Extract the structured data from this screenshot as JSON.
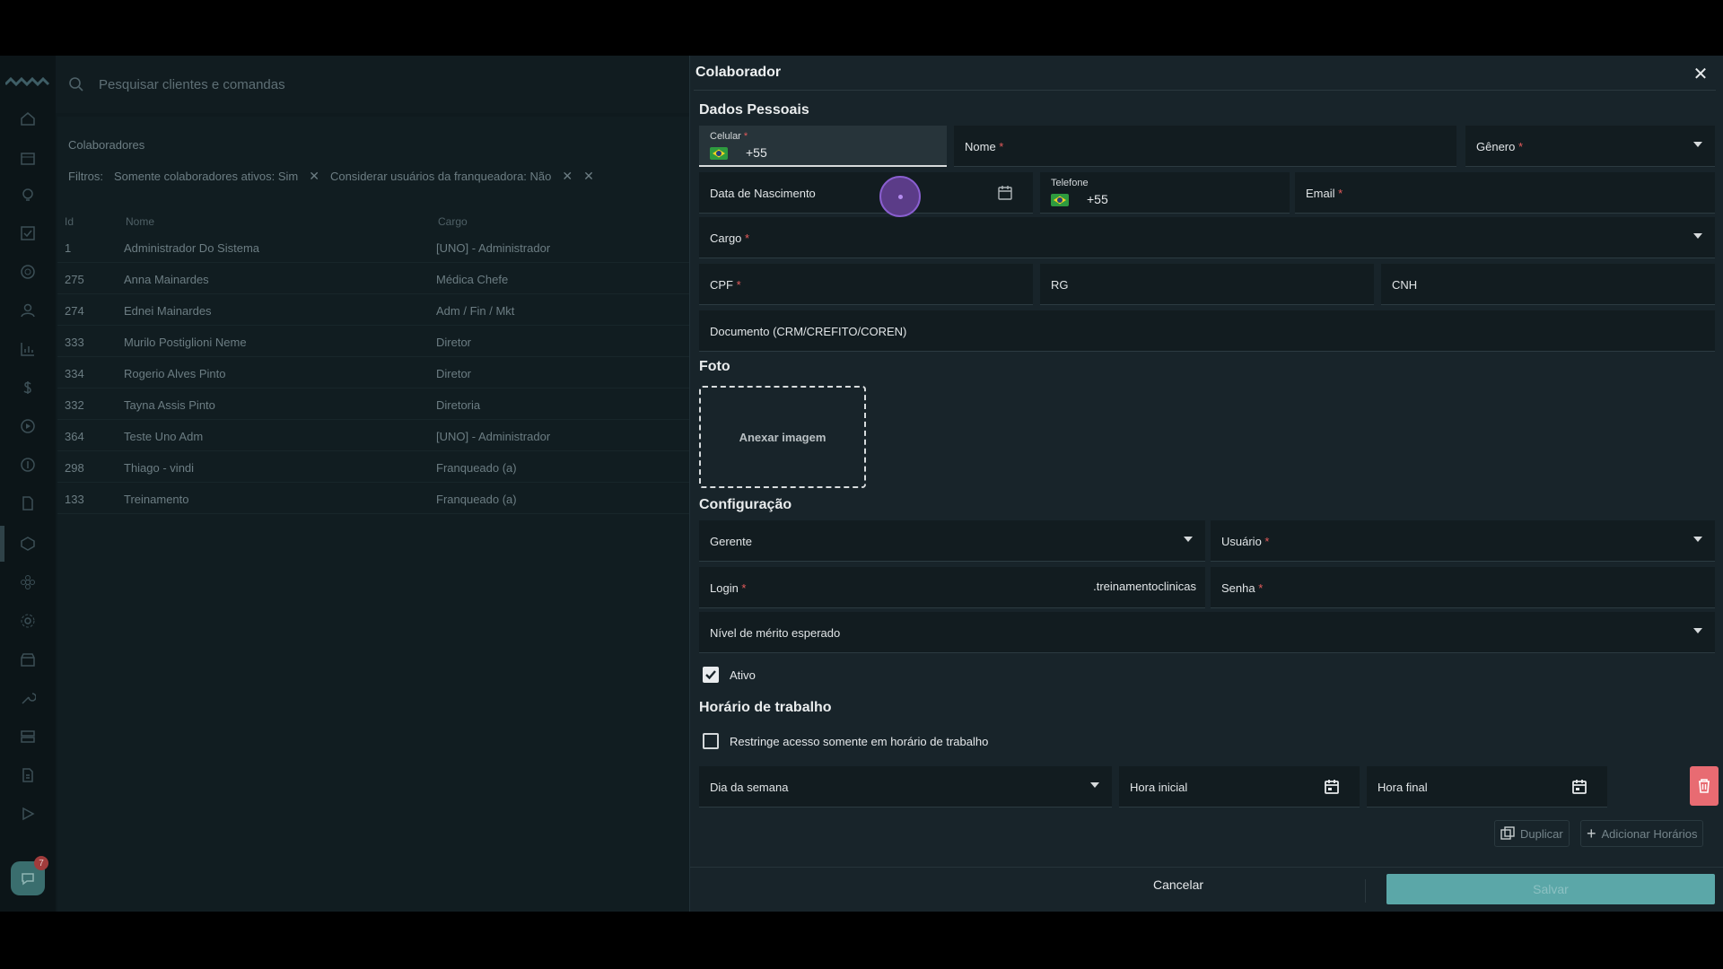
{
  "search": {
    "placeholder": "Pesquisar clientes e comandas"
  },
  "list": {
    "title": "Colaboradores",
    "filters_label": "Filtros:",
    "filters": [
      "Somente colaboradores ativos: Sim",
      "Considerar usuários da franqueadora: Não"
    ],
    "columns": {
      "id": "Id",
      "nome": "Nome",
      "cargo": "Cargo"
    },
    "rows": [
      {
        "id": "1",
        "nome": "Administrador Do Sistema",
        "cargo": "[UNO] - Administrador"
      },
      {
        "id": "275",
        "nome": "Anna Mainardes",
        "cargo": "Médica Chefe"
      },
      {
        "id": "274",
        "nome": "Ednei Mainardes",
        "cargo": "Adm / Fin / Mkt"
      },
      {
        "id": "333",
        "nome": "Murilo Postiglioni Neme",
        "cargo": "Diretor"
      },
      {
        "id": "334",
        "nome": "Rogerio Alves Pinto",
        "cargo": "Diretor"
      },
      {
        "id": "332",
        "nome": "Tayna Assis Pinto",
        "cargo": "Diretoria"
      },
      {
        "id": "364",
        "nome": "Teste Uno Adm",
        "cargo": "[UNO] - Administrador"
      },
      {
        "id": "298",
        "nome": "Thiago - vindi",
        "cargo": "Franqueado (a)"
      },
      {
        "id": "133",
        "nome": "Treinamento",
        "cargo": "Franqueado (a)"
      }
    ]
  },
  "rail": {
    "badge_count": "7"
  },
  "modal": {
    "title": "Colaborador",
    "dados_pessoais": "Dados Pessoais",
    "celular_label": "Celular",
    "celular_value": "+55",
    "nome_label": "Nome",
    "genero_label": "Gênero",
    "nascimento_label": "Data de Nascimento",
    "telefone_label": "Telefone",
    "telefone_value": "+55",
    "email_label": "Email",
    "cargo_label": "Cargo",
    "cpf_label": "CPF",
    "rg_label": "RG",
    "cnh_label": "CNH",
    "documento_label": "Documento (CRM/CREFITO/COREN)",
    "foto_title": "Foto",
    "anexar_label": "Anexar imagem",
    "configuracao_title": "Configuração",
    "gerente_label": "Gerente",
    "usuario_label": "Usuário",
    "login_label": "Login",
    "login_suffix": ".treinamentoclinicas",
    "senha_label": "Senha",
    "merito_label": "Nível de mérito esperado",
    "ativo_label": "Ativo",
    "ativo_checked": true,
    "horario_title": "Horário de trabalho",
    "restringe_label": "Restringe acesso somente em horário de trabalho",
    "restringe_checked": false,
    "dia_label": "Dia da semana",
    "hora_inicial_label": "Hora inicial",
    "hora_final_label": "Hora final",
    "duplicar_label": "Duplicar",
    "adicionar_label": "Adicionar Horários",
    "cancelar_label": "Cancelar",
    "salvar_label": "Salvar"
  }
}
